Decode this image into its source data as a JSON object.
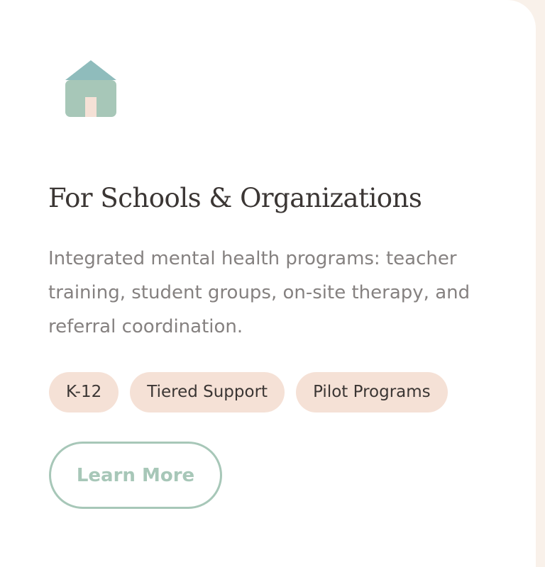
{
  "card": {
    "icon": "house-icon",
    "title": "For Schools & Organizations",
    "description": "Integrated mental health programs: teacher training, student groups, on-site therapy, and referral coordination.",
    "tags": [
      "K-12",
      "Tiered Support",
      "Pilot Programs"
    ],
    "cta_label": "Learn More"
  },
  "colors": {
    "page_background": "#f9f1ea",
    "card_background": "#ffffff",
    "roof": "#8fbcbc",
    "house_body": "#a7c7b8",
    "door": "#f5e1d6",
    "tag_background": "#f5e1d6",
    "accent": "#a7c7b8",
    "title_text": "#3b3634",
    "body_text": "#858180"
  }
}
